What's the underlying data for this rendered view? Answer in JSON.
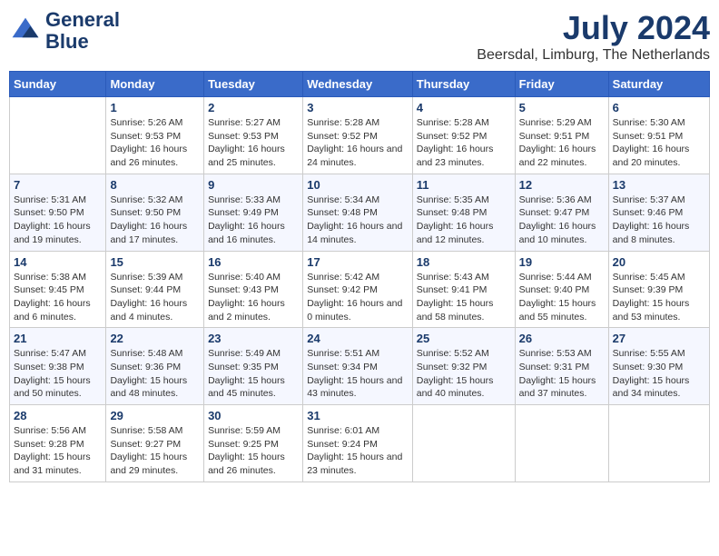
{
  "logo": {
    "line1": "General",
    "line2": "Blue"
  },
  "title": "July 2024",
  "subtitle": "Beersdal, Limburg, The Netherlands",
  "headers": [
    "Sunday",
    "Monday",
    "Tuesday",
    "Wednesday",
    "Thursday",
    "Friday",
    "Saturday"
  ],
  "weeks": [
    [
      {
        "day": "",
        "sunrise": "",
        "sunset": "",
        "daylight": ""
      },
      {
        "day": "1",
        "sunrise": "Sunrise: 5:26 AM",
        "sunset": "Sunset: 9:53 PM",
        "daylight": "Daylight: 16 hours and 26 minutes."
      },
      {
        "day": "2",
        "sunrise": "Sunrise: 5:27 AM",
        "sunset": "Sunset: 9:53 PM",
        "daylight": "Daylight: 16 hours and 25 minutes."
      },
      {
        "day": "3",
        "sunrise": "Sunrise: 5:28 AM",
        "sunset": "Sunset: 9:52 PM",
        "daylight": "Daylight: 16 hours and 24 minutes."
      },
      {
        "day": "4",
        "sunrise": "Sunrise: 5:28 AM",
        "sunset": "Sunset: 9:52 PM",
        "daylight": "Daylight: 16 hours and 23 minutes."
      },
      {
        "day": "5",
        "sunrise": "Sunrise: 5:29 AM",
        "sunset": "Sunset: 9:51 PM",
        "daylight": "Daylight: 16 hours and 22 minutes."
      },
      {
        "day": "6",
        "sunrise": "Sunrise: 5:30 AM",
        "sunset": "Sunset: 9:51 PM",
        "daylight": "Daylight: 16 hours and 20 minutes."
      }
    ],
    [
      {
        "day": "7",
        "sunrise": "Sunrise: 5:31 AM",
        "sunset": "Sunset: 9:50 PM",
        "daylight": "Daylight: 16 hours and 19 minutes."
      },
      {
        "day": "8",
        "sunrise": "Sunrise: 5:32 AM",
        "sunset": "Sunset: 9:50 PM",
        "daylight": "Daylight: 16 hours and 17 minutes."
      },
      {
        "day": "9",
        "sunrise": "Sunrise: 5:33 AM",
        "sunset": "Sunset: 9:49 PM",
        "daylight": "Daylight: 16 hours and 16 minutes."
      },
      {
        "day": "10",
        "sunrise": "Sunrise: 5:34 AM",
        "sunset": "Sunset: 9:48 PM",
        "daylight": "Daylight: 16 hours and 14 minutes."
      },
      {
        "day": "11",
        "sunrise": "Sunrise: 5:35 AM",
        "sunset": "Sunset: 9:48 PM",
        "daylight": "Daylight: 16 hours and 12 minutes."
      },
      {
        "day": "12",
        "sunrise": "Sunrise: 5:36 AM",
        "sunset": "Sunset: 9:47 PM",
        "daylight": "Daylight: 16 hours and 10 minutes."
      },
      {
        "day": "13",
        "sunrise": "Sunrise: 5:37 AM",
        "sunset": "Sunset: 9:46 PM",
        "daylight": "Daylight: 16 hours and 8 minutes."
      }
    ],
    [
      {
        "day": "14",
        "sunrise": "Sunrise: 5:38 AM",
        "sunset": "Sunset: 9:45 PM",
        "daylight": "Daylight: 16 hours and 6 minutes."
      },
      {
        "day": "15",
        "sunrise": "Sunrise: 5:39 AM",
        "sunset": "Sunset: 9:44 PM",
        "daylight": "Daylight: 16 hours and 4 minutes."
      },
      {
        "day": "16",
        "sunrise": "Sunrise: 5:40 AM",
        "sunset": "Sunset: 9:43 PM",
        "daylight": "Daylight: 16 hours and 2 minutes."
      },
      {
        "day": "17",
        "sunrise": "Sunrise: 5:42 AM",
        "sunset": "Sunset: 9:42 PM",
        "daylight": "Daylight: 16 hours and 0 minutes."
      },
      {
        "day": "18",
        "sunrise": "Sunrise: 5:43 AM",
        "sunset": "Sunset: 9:41 PM",
        "daylight": "Daylight: 15 hours and 58 minutes."
      },
      {
        "day": "19",
        "sunrise": "Sunrise: 5:44 AM",
        "sunset": "Sunset: 9:40 PM",
        "daylight": "Daylight: 15 hours and 55 minutes."
      },
      {
        "day": "20",
        "sunrise": "Sunrise: 5:45 AM",
        "sunset": "Sunset: 9:39 PM",
        "daylight": "Daylight: 15 hours and 53 minutes."
      }
    ],
    [
      {
        "day": "21",
        "sunrise": "Sunrise: 5:47 AM",
        "sunset": "Sunset: 9:38 PM",
        "daylight": "Daylight: 15 hours and 50 minutes."
      },
      {
        "day": "22",
        "sunrise": "Sunrise: 5:48 AM",
        "sunset": "Sunset: 9:36 PM",
        "daylight": "Daylight: 15 hours and 48 minutes."
      },
      {
        "day": "23",
        "sunrise": "Sunrise: 5:49 AM",
        "sunset": "Sunset: 9:35 PM",
        "daylight": "Daylight: 15 hours and 45 minutes."
      },
      {
        "day": "24",
        "sunrise": "Sunrise: 5:51 AM",
        "sunset": "Sunset: 9:34 PM",
        "daylight": "Daylight: 15 hours and 43 minutes."
      },
      {
        "day": "25",
        "sunrise": "Sunrise: 5:52 AM",
        "sunset": "Sunset: 9:32 PM",
        "daylight": "Daylight: 15 hours and 40 minutes."
      },
      {
        "day": "26",
        "sunrise": "Sunrise: 5:53 AM",
        "sunset": "Sunset: 9:31 PM",
        "daylight": "Daylight: 15 hours and 37 minutes."
      },
      {
        "day": "27",
        "sunrise": "Sunrise: 5:55 AM",
        "sunset": "Sunset: 9:30 PM",
        "daylight": "Daylight: 15 hours and 34 minutes."
      }
    ],
    [
      {
        "day": "28",
        "sunrise": "Sunrise: 5:56 AM",
        "sunset": "Sunset: 9:28 PM",
        "daylight": "Daylight: 15 hours and 31 minutes."
      },
      {
        "day": "29",
        "sunrise": "Sunrise: 5:58 AM",
        "sunset": "Sunset: 9:27 PM",
        "daylight": "Daylight: 15 hours and 29 minutes."
      },
      {
        "day": "30",
        "sunrise": "Sunrise: 5:59 AM",
        "sunset": "Sunset: 9:25 PM",
        "daylight": "Daylight: 15 hours and 26 minutes."
      },
      {
        "day": "31",
        "sunrise": "Sunrise: 6:01 AM",
        "sunset": "Sunset: 9:24 PM",
        "daylight": "Daylight: 15 hours and 23 minutes."
      },
      {
        "day": "",
        "sunrise": "",
        "sunset": "",
        "daylight": ""
      },
      {
        "day": "",
        "sunrise": "",
        "sunset": "",
        "daylight": ""
      },
      {
        "day": "",
        "sunrise": "",
        "sunset": "",
        "daylight": ""
      }
    ]
  ]
}
